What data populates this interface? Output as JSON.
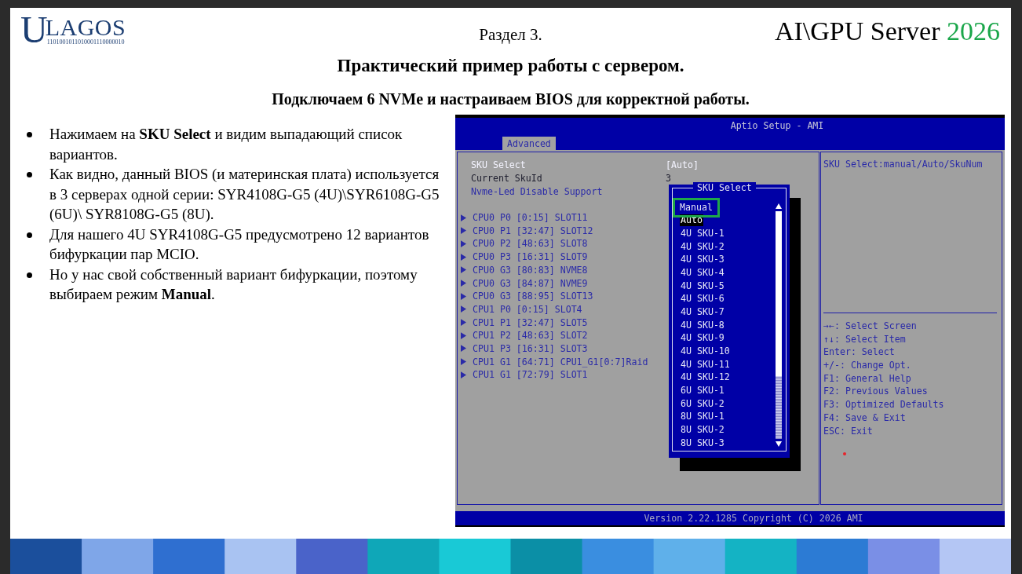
{
  "slide": {
    "logo": {
      "initial": "U",
      "rest": "LAGOS",
      "binary": "1101001011010001110000010"
    },
    "section": "Раздел 3.",
    "series_title": {
      "text": "AI\\GPU Server",
      "year": "2026"
    },
    "title": "Практический пример работы с сервером.",
    "subtitle": "Подключаем 6 NVMe и настраиваем BIOS для корректной работы.",
    "bullets": [
      "Нажимаем на **SKU Select** и видим выпадающий список вариантов.",
      "Как видно, данный BIOS (и материнская плата) используется в 3 серверах одной серии: SYR4108G-G5 (4U)\\SYR6108G-G5 (6U)\\ SYR8108G-G5 (8U).",
      "Для нашего 4U SYR4108G-G5 предусмотрено 12 вариантов бифуркации пар MCIO.",
      "Но у нас свой собственный вариант бифуркации, поэтому выбираем режим **Manual**."
    ]
  },
  "bios": {
    "title": "Aptio Setup - AMI",
    "tabs": [
      {
        "label": "Advanced",
        "selected": true
      }
    ],
    "items": [
      {
        "kind": "setting",
        "label": "SKU Select",
        "value": "[Auto]",
        "selected": true
      },
      {
        "kind": "info",
        "label": "Current SkuId",
        "value": "3",
        "selected": false
      },
      {
        "kind": "setting",
        "label": "Nvme-Led Disable Support",
        "selected": false
      },
      {
        "kind": "submenu",
        "label": "CPU0 P0 [0:15] SLOT11",
        "selected": false
      },
      {
        "kind": "submenu",
        "label": "CPU0 P1 [32:47] SLOT12",
        "selected": false
      },
      {
        "kind": "submenu",
        "label": "CPU0 P2 [48:63] SLOT8",
        "selected": false
      },
      {
        "kind": "submenu",
        "label": "CPU0 P3 [16:31] SLOT9",
        "selected": false
      },
      {
        "kind": "submenu",
        "label": "CPU0 G3 [80:83] NVME8",
        "selected": false
      },
      {
        "kind": "submenu",
        "label": "CPU0 G3 [84:87] NVME9",
        "selected": false
      },
      {
        "kind": "submenu",
        "label": "CPU0 G3 [88:95] SLOT13",
        "selected": false
      },
      {
        "kind": "submenu",
        "label": "CPU1 P0 [0:15] SLOT4",
        "selected": false
      },
      {
        "kind": "submenu",
        "label": "CPU1 P1 [32:47] SLOT5",
        "selected": false
      },
      {
        "kind": "submenu",
        "label": "CPU1 P2 [48:63] SLOT2",
        "selected": false
      },
      {
        "kind": "submenu",
        "label": "CPU1 P3 [16:31] SLOT3",
        "selected": false
      },
      {
        "kind": "submenu",
        "label": "CPU1 G1 [64:71] CPU1_G1[0:7]Raid",
        "selected": false
      },
      {
        "kind": "submenu",
        "label": "CPU1 G1 [72:79] SLOT1",
        "selected": false
      }
    ],
    "popup": {
      "title": "SKU Select",
      "options": [
        {
          "label": "Manual",
          "selected": false,
          "outlined": true
        },
        {
          "label": "Auto",
          "selected": true,
          "outlined": false
        },
        {
          "label": "4U SKU-1",
          "selected": false,
          "outlined": false
        },
        {
          "label": "4U SKU-2",
          "selected": false,
          "outlined": false
        },
        {
          "label": "4U SKU-3",
          "selected": false,
          "outlined": false
        },
        {
          "label": "4U SKU-4",
          "selected": false,
          "outlined": false
        },
        {
          "label": "4U SKU-5",
          "selected": false,
          "outlined": false
        },
        {
          "label": "4U SKU-6",
          "selected": false,
          "outlined": false
        },
        {
          "label": "4U SKU-7",
          "selected": false,
          "outlined": false
        },
        {
          "label": "4U SKU-8",
          "selected": false,
          "outlined": false
        },
        {
          "label": "4U SKU-9",
          "selected": false,
          "outlined": false
        },
        {
          "label": "4U SKU-10",
          "selected": false,
          "outlined": false
        },
        {
          "label": "4U SKU-11",
          "selected": false,
          "outlined": false
        },
        {
          "label": "4U SKU-12",
          "selected": false,
          "outlined": false
        },
        {
          "label": "6U SKU-1",
          "selected": false,
          "outlined": false
        },
        {
          "label": "6U SKU-2",
          "selected": false,
          "outlined": false
        },
        {
          "label": "8U SKU-1",
          "selected": false,
          "outlined": false
        },
        {
          "label": "8U SKU-2",
          "selected": false,
          "outlined": false
        },
        {
          "label": "8U SKU-3",
          "selected": false,
          "outlined": false
        }
      ]
    },
    "help": "SKU Select:manual/Auto/SkuNum",
    "keys": [
      "→←: Select Screen",
      "↑↓: Select Item",
      "Enter: Select",
      "+/-: Change Opt.",
      "F1: General Help",
      "F2: Previous Values",
      "F3: Optimized Defaults",
      "F4: Save & Exit",
      "ESC: Exit"
    ],
    "footer": "Version 2.22.1285 Copyright (C) 2026 AMI"
  }
}
